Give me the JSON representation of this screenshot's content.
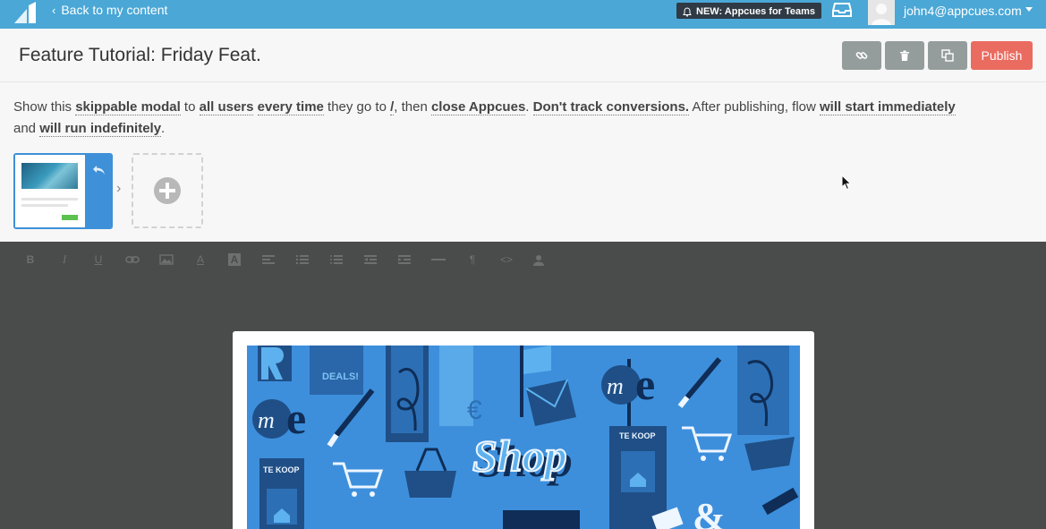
{
  "topbar": {
    "back_label": "Back to my content",
    "news_label": "NEW: Appcues for Teams",
    "user_email": "john4@appcues.com"
  },
  "header": {
    "title": "Feature Tutorial: Friday Feat.",
    "publish_label": "Publish",
    "icons": [
      "link-icon",
      "trash-icon",
      "duplicate-icon"
    ]
  },
  "settings": {
    "p1": "Show this ",
    "o1": "skippable modal",
    "p2": " to ",
    "o2": "all users",
    "p3": " ",
    "o3": "every time",
    "p4": " they go to ",
    "o4": "/",
    "p5": ", then ",
    "o5": "close Appcues",
    "p6": ".  ",
    "o6": "Don't track conversions.",
    "p7": "  After publishing, flow ",
    "o7": "will start immediately",
    "p8": " and ",
    "o8": "will run indefinitely",
    "p9": "."
  },
  "modal_image": {
    "text_shop": "Shop",
    "text_tekoop": "TE KOOP",
    "text_deals": "DEALS!"
  },
  "colors": {
    "topbar": "#4aa7d6",
    "publish": "#ea6b5f",
    "gray_button": "#959c9c",
    "step_accent": "#3e90d8",
    "editor_bg": "#4a4b4b"
  }
}
